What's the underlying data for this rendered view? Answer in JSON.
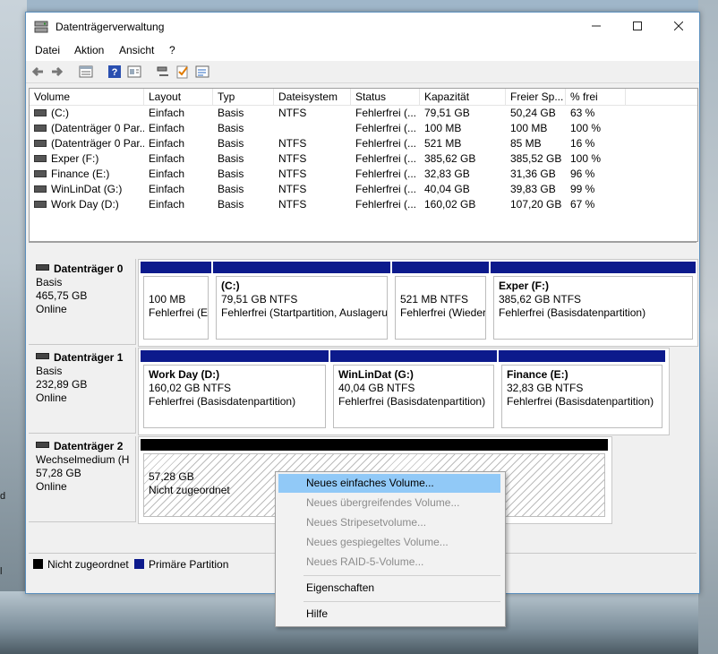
{
  "window": {
    "title": "Datenträgerverwaltung"
  },
  "menu": [
    "Datei",
    "Aktion",
    "Ansicht",
    "?"
  ],
  "toolbar": {
    "icons": [
      "back-icon",
      "forward-icon",
      "list-view-icon",
      "help-icon",
      "properties-icon",
      "connect-icon",
      "check-icon",
      "settings-icon"
    ]
  },
  "volume_table": {
    "columns": [
      "Volume",
      "Layout",
      "Typ",
      "Dateisystem",
      "Status",
      "Kapazität",
      "Freier Sp...",
      "% frei"
    ],
    "rows": [
      [
        "(C:)",
        "Einfach",
        "Basis",
        "NTFS",
        "Fehlerfrei (...",
        "79,51 GB",
        "50,24 GB",
        "63 %"
      ],
      [
        "(Datenträger 0 Par...",
        "Einfach",
        "Basis",
        "",
        "Fehlerfrei (...",
        "100 MB",
        "100 MB",
        "100 %"
      ],
      [
        "(Datenträger 0 Par...",
        "Einfach",
        "Basis",
        "NTFS",
        "Fehlerfrei (...",
        "521 MB",
        "85 MB",
        "16 %"
      ],
      [
        "Exper (F:)",
        "Einfach",
        "Basis",
        "NTFS",
        "Fehlerfrei (...",
        "385,62 GB",
        "385,52 GB",
        "100 %"
      ],
      [
        "Finance (E:)",
        "Einfach",
        "Basis",
        "NTFS",
        "Fehlerfrei (...",
        "32,83 GB",
        "31,36 GB",
        "96 %"
      ],
      [
        "WinLinDat (G:)",
        "Einfach",
        "Basis",
        "NTFS",
        "Fehlerfrei (...",
        "40,04 GB",
        "39,83 GB",
        "99 %"
      ],
      [
        "Work Day (D:)",
        "Einfach",
        "Basis",
        "NTFS",
        "Fehlerfrei (...",
        "160,02 GB",
        "107,20 GB",
        "67 %"
      ]
    ]
  },
  "disks": [
    {
      "name": "Datenträger 0",
      "type": "Basis",
      "size": "465,75 GB",
      "status": "Online",
      "partitions": [
        {
          "name": "",
          "size": "100 MB",
          "status": "Fehlerfrei (EFI-Systempartition)"
        },
        {
          "name": "(C:)",
          "size": "79,51 GB NTFS",
          "status": "Fehlerfrei (Startpartition, Auslagerungsdatei)"
        },
        {
          "name": "",
          "size": "521 MB NTFS",
          "status": "Fehlerfrei (Wiederherstellungspartition)"
        },
        {
          "name": "Exper  (F:)",
          "size": "385,62 GB NTFS",
          "status": "Fehlerfrei (Basisdatenpartition)"
        }
      ]
    },
    {
      "name": "Datenträger 1",
      "type": "Basis",
      "size": "232,89 GB",
      "status": "Online",
      "partitions": [
        {
          "name": "Work Day  (D:)",
          "size": "160,02 GB NTFS",
          "status": "Fehlerfrei (Basisdatenpartition)"
        },
        {
          "name": "WinLinDat  (G:)",
          "size": "40,04 GB NTFS",
          "status": "Fehlerfrei (Basisdatenpartition)"
        },
        {
          "name": "Finance  (E:)",
          "size": "32,83 GB NTFS",
          "status": "Fehlerfrei (Basisdatenpartition)"
        }
      ]
    },
    {
      "name": "Datenträger 2",
      "type": "Wechselmedium (H",
      "size": "57,28 GB",
      "status": "Online",
      "partitions": [
        {
          "name": "",
          "size": "57,28 GB",
          "status": "Nicht zugeordnet"
        }
      ]
    }
  ],
  "legend": [
    {
      "label": "Nicht zugeordnet",
      "color": "#000000"
    },
    {
      "label": "Primäre Partition",
      "color": "#0c1a8c"
    }
  ],
  "context_menu": {
    "items": [
      {
        "label": "Neues einfaches Volume...",
        "enabled": true,
        "highlighted": true
      },
      {
        "label": "Neues übergreifendes Volume...",
        "enabled": false
      },
      {
        "label": "Neues Stripesetvolume...",
        "enabled": false
      },
      {
        "label": "Neues gespiegeltes Volume...",
        "enabled": false
      },
      {
        "label": "Neues RAID-5-Volume...",
        "enabled": false
      },
      {
        "label": "Eigenschaften",
        "enabled": true
      },
      {
        "label": "Hilfe",
        "enabled": true
      }
    ]
  },
  "desktop_edge": [
    "d",
    "l"
  ]
}
